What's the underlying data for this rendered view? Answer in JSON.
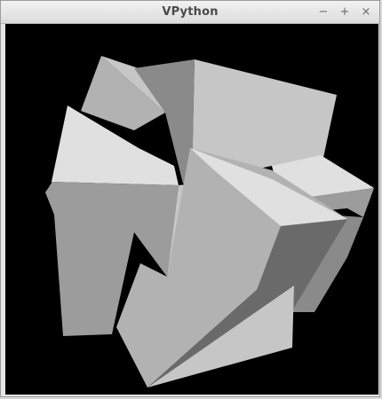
{
  "window": {
    "title": "VPython",
    "buttons": {
      "minimize": "−",
      "maximize": "+",
      "close": "×"
    }
  },
  "scene": {
    "background_color": "#000000",
    "face_colors": {
      "lightest": "#e0e0e0",
      "light": "#c6c6c6",
      "mid": "#b2b2b2",
      "midDark": "#9c9c9c",
      "dark": "#8a8a8a",
      "darkest": "#6a6a6a"
    }
  }
}
